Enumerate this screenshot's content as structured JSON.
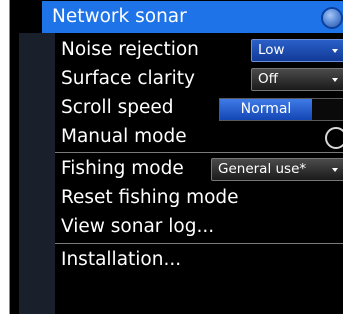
{
  "menu": {
    "header": {
      "label": "Network sonar",
      "toggle_on": true
    },
    "items": [
      {
        "label": "Noise rejection",
        "control": "dropdown",
        "value": "Low"
      },
      {
        "label": "Surface clarity",
        "control": "dropdown",
        "value": "Off"
      },
      {
        "label": "Scroll speed",
        "control": "slider",
        "value": "Normal",
        "level": 0.72
      },
      {
        "label": "Manual mode",
        "control": "radio",
        "checked": false
      },
      {
        "label": "Fishing mode",
        "control": "dropdown",
        "value": "General use*"
      },
      {
        "label": "Reset fishing mode"
      },
      {
        "label": "View sonar log..."
      },
      {
        "label": "Installation..."
      }
    ]
  },
  "colors": {
    "highlight": "#1f73e8",
    "background": "#000000",
    "gutter": "#1a1f2c"
  }
}
